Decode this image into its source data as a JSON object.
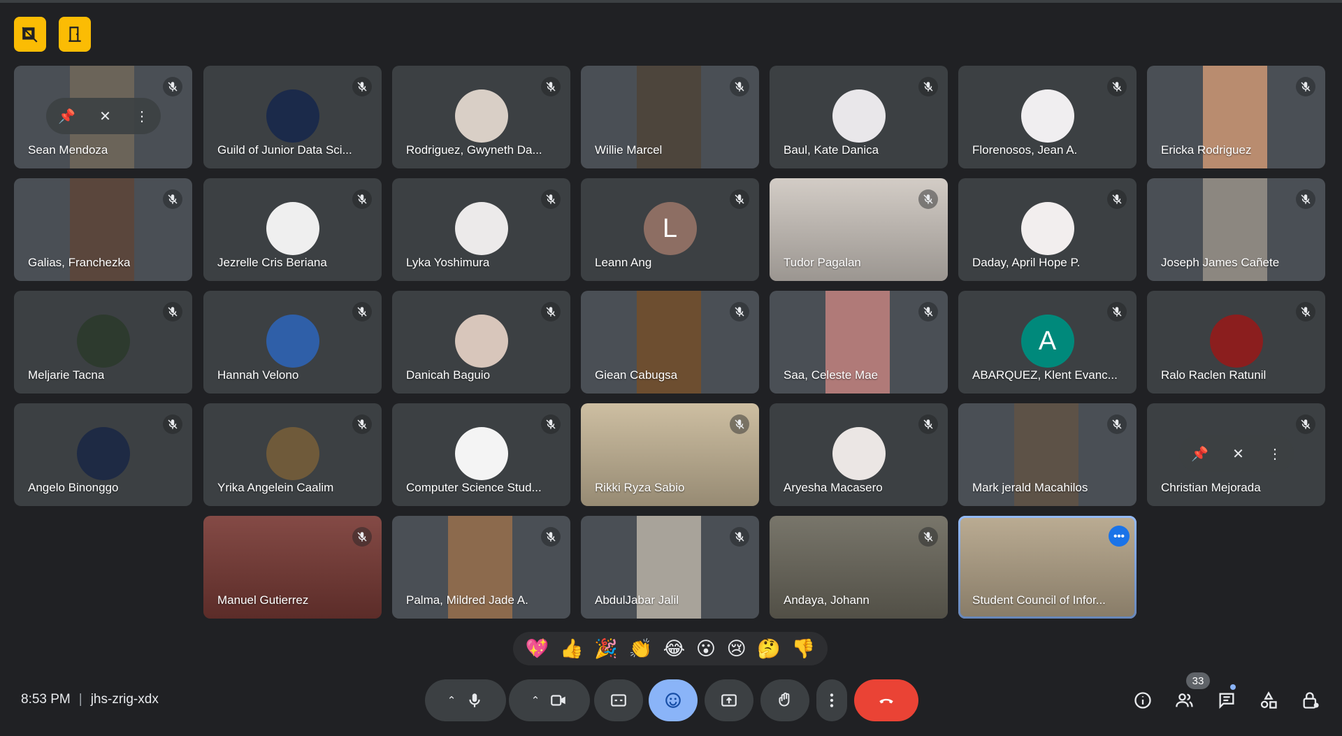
{
  "host_controls": [
    {
      "icon": "video-off-layout-icon"
    },
    {
      "icon": "door-icon"
    }
  ],
  "participants": [
    {
      "name": "Sean Mendoza",
      "type": "video",
      "color": "#6b6459",
      "hover": true
    },
    {
      "name": "Guild of Junior Data Sci...",
      "type": "avatar",
      "color": "#1b2a4a"
    },
    {
      "name": "Rodriguez, Gwyneth Da...",
      "type": "avatar",
      "color": "#d9cfc6"
    },
    {
      "name": "Willie Marcel",
      "type": "video",
      "color": "#4d453c"
    },
    {
      "name": "Baul, Kate Danica",
      "type": "avatar",
      "color": "#e9e7ea"
    },
    {
      "name": "Florenosos, Jean A.",
      "type": "avatar",
      "color": "#f0eef0"
    },
    {
      "name": "Ericka Rodriguez",
      "type": "video",
      "color": "#b98c6f"
    },
    {
      "name": "Galias, Franchezka",
      "type": "video",
      "color": "#5a463c"
    },
    {
      "name": "Jezrelle Cris Beriana",
      "type": "avatar",
      "color": "#efefef"
    },
    {
      "name": "Lyka Yoshimura",
      "type": "avatar",
      "color": "#eceaea"
    },
    {
      "name": "Leann Ang",
      "type": "letter",
      "letter": "L",
      "color": "#8d6e63"
    },
    {
      "name": "Tudor Pagalan",
      "type": "fullvideo",
      "color": "#cfc8c1"
    },
    {
      "name": "Daday, April Hope P.",
      "type": "avatar",
      "color": "#f2eeee"
    },
    {
      "name": "Joseph James Cañete",
      "type": "video",
      "color": "#8c8780"
    },
    {
      "name": "Meljarie Tacna",
      "type": "avatar",
      "color": "#2d3a2e"
    },
    {
      "name": "Hannah Velono",
      "type": "avatar",
      "color": "#2f5fa8"
    },
    {
      "name": "Danicah Baguio",
      "type": "avatar",
      "color": "#d8c6bb"
    },
    {
      "name": "Giean Cabugsa",
      "type": "video",
      "color": "#6d4e30"
    },
    {
      "name": "Saa, Celeste Mae",
      "type": "video",
      "color": "#b07a78"
    },
    {
      "name": "ABARQUEZ, Klent Evanc...",
      "type": "letter",
      "letter": "A",
      "color": "#00897b"
    },
    {
      "name": "Ralo Raclen Ratunil",
      "type": "avatar",
      "color": "#8b1e1e"
    },
    {
      "name": "Angelo Binonggo",
      "type": "avatar",
      "color": "#1e2a44"
    },
    {
      "name": "Yrika Angelein Caalim",
      "type": "avatar",
      "color": "#6f5a3a"
    },
    {
      "name": "Computer Science Stud...",
      "type": "avatar",
      "color": "#f4f4f4"
    },
    {
      "name": "Rikki Ryza Sabio",
      "type": "fullvideo",
      "color": "#c9b99a"
    },
    {
      "name": "Aryesha Macasero",
      "type": "avatar",
      "color": "#ebe6e4"
    },
    {
      "name": "Mark jerald Macahilos",
      "type": "video",
      "color": "#5d5247"
    },
    {
      "name": "Christian Mejorada",
      "type": "blank",
      "color": "#3c4043",
      "hover": true
    },
    {
      "name": "Manuel Gutierrez",
      "type": "fullvideo",
      "color": "#7a3b36"
    },
    {
      "name": "Palma, Mildred Jade A.",
      "type": "video",
      "color": "#8c6a4d"
    },
    {
      "name": "AbdulJabar Jalil",
      "type": "video",
      "color": "#a8a39a"
    },
    {
      "name": "Andaya, Johann",
      "type": "fullvideo",
      "color": "#6d6a5e"
    },
    {
      "name": "Student Council of Infor...",
      "type": "fullvideo",
      "color": "#b5a58a",
      "active": true
    }
  ],
  "reactions": [
    "💖",
    "👍",
    "🎉",
    "👏",
    "😂",
    "😮",
    "😢",
    "🤔",
    "👎"
  ],
  "meeting": {
    "time": "8:53 PM",
    "code": "jhs-zrig-xdx"
  },
  "people_count": "33",
  "colors": {
    "background": "#202124",
    "tile": "#3c4043",
    "end_call": "#ea4335",
    "active_reaction": "#8ab4f8",
    "host_yellow": "#fbbc04"
  }
}
